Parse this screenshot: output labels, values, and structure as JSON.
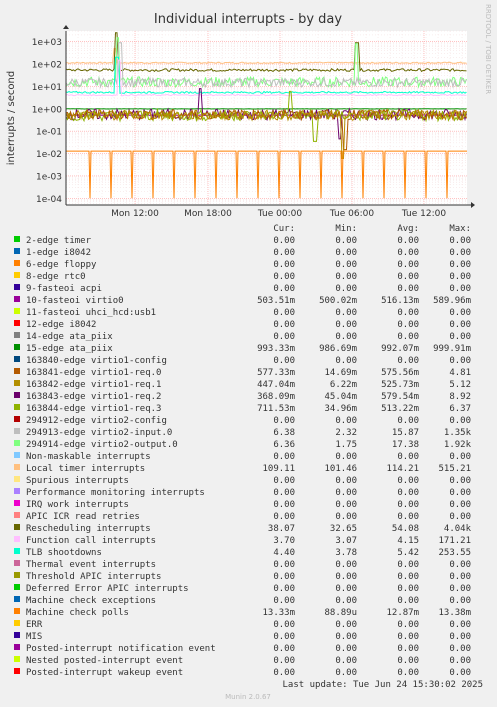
{
  "chart_data": {
    "type": "line",
    "title": "Individual interrupts - by day",
    "ylabel": "interrupts / second",
    "side_label": "RRDTOOL / TOBI OETIKER",
    "y_scale": "log",
    "ylim": [
      5e-05,
      3000
    ],
    "y_ticks": [
      "1e+03",
      "1e+02",
      "1e+01",
      "1e+00",
      "1e-01",
      "1e-02",
      "1e-03",
      "1e-04"
    ],
    "x_ticks": [
      "Mon 12:00",
      "Mon 18:00",
      "Tue 00:00",
      "Tue 06:00",
      "Tue 12:00"
    ],
    "grid": true,
    "background": "#ffffff",
    "grid_color": "#ff9f9f",
    "columns": [
      "Cur:",
      "Min:",
      "Avg:",
      "Max:"
    ],
    "series": [
      {
        "name": "2-edge      timer",
        "color": "#00cc00",
        "cur": "0.00",
        "min": "0.00",
        "avg": "0.00",
        "max": "0.00"
      },
      {
        "name": "1-edge      i8042",
        "color": "#0066b3",
        "cur": "0.00",
        "min": "0.00",
        "avg": "0.00",
        "max": "0.00"
      },
      {
        "name": "6-edge      floppy",
        "color": "#ff8000",
        "cur": "0.00",
        "min": "0.00",
        "avg": "0.00",
        "max": "0.00"
      },
      {
        "name": "8-edge      rtc0",
        "color": "#ffcc00",
        "cur": "0.00",
        "min": "0.00",
        "avg": "0.00",
        "max": "0.00"
      },
      {
        "name": "9-fasteoi   acpi",
        "color": "#330099",
        "cur": "0.00",
        "min": "0.00",
        "avg": "0.00",
        "max": "0.00"
      },
      {
        "name": "10-fasteoi   virtio0",
        "color": "#990099",
        "cur": "503.51m",
        "min": "500.02m",
        "avg": "516.13m",
        "max": "589.96m"
      },
      {
        "name": "11-fasteoi   uhci_hcd:usb1",
        "color": "#ccff00",
        "cur": "0.00",
        "min": "0.00",
        "avg": "0.00",
        "max": "0.00"
      },
      {
        "name": "12-edge      i8042",
        "color": "#ff0000",
        "cur": "0.00",
        "min": "0.00",
        "avg": "0.00",
        "max": "0.00"
      },
      {
        "name": "14-edge      ata_piix",
        "color": "#808080",
        "cur": "0.00",
        "min": "0.00",
        "avg": "0.00",
        "max": "0.00"
      },
      {
        "name": "15-edge      ata_piix",
        "color": "#008f00",
        "cur": "993.33m",
        "min": "986.69m",
        "avg": "992.07m",
        "max": "999.91m"
      },
      {
        "name": "163840-edge      virtio1-config",
        "color": "#00487d",
        "cur": "0.00",
        "min": "0.00",
        "avg": "0.00",
        "max": "0.00"
      },
      {
        "name": "163841-edge      virtio1-req.0",
        "color": "#b35a00",
        "cur": "577.33m",
        "min": "14.69m",
        "avg": "575.56m",
        "max": "4.81"
      },
      {
        "name": "163842-edge      virtio1-req.1",
        "color": "#b38f00",
        "cur": "447.04m",
        "min": "6.22m",
        "avg": "525.73m",
        "max": "5.12"
      },
      {
        "name": "163843-edge      virtio1-req.2",
        "color": "#6b006b",
        "cur": "368.09m",
        "min": "45.04m",
        "avg": "579.54m",
        "max": "8.92"
      },
      {
        "name": "163844-edge      virtio1-req.3",
        "color": "#8fb300",
        "cur": "711.53m",
        "min": "34.96m",
        "avg": "513.22m",
        "max": "6.37"
      },
      {
        "name": "294912-edge      virtio2-config",
        "color": "#b30000",
        "cur": "0.00",
        "min": "0.00",
        "avg": "0.00",
        "max": "0.00"
      },
      {
        "name": "294913-edge      virtio2-input.0",
        "color": "#bebebe",
        "cur": "6.38",
        "min": "2.32",
        "avg": "15.87",
        "max": "1.35k"
      },
      {
        "name": "294914-edge      virtio2-output.0",
        "color": "#80ff80",
        "cur": "6.36",
        "min": "1.75",
        "avg": "17.38",
        "max": "1.92k"
      },
      {
        "name": "Non-maskable interrupts",
        "color": "#80c9ff",
        "cur": "0.00",
        "min": "0.00",
        "avg": "0.00",
        "max": "0.00"
      },
      {
        "name": "Local timer interrupts",
        "color": "#ffc080",
        "cur": "109.11",
        "min": "101.46",
        "avg": "114.21",
        "max": "515.21"
      },
      {
        "name": "Spurious interrupts",
        "color": "#ffe680",
        "cur": "0.00",
        "min": "0.00",
        "avg": "0.00",
        "max": "0.00"
      },
      {
        "name": "Performance monitoring interrupts",
        "color": "#aa80ff",
        "cur": "0.00",
        "min": "0.00",
        "avg": "0.00",
        "max": "0.00"
      },
      {
        "name": "IRQ work interrupts",
        "color": "#ee00cc",
        "cur": "0.00",
        "min": "0.00",
        "avg": "0.00",
        "max": "0.00"
      },
      {
        "name": "APIC ICR read retries",
        "color": "#ff8080",
        "cur": "0.00",
        "min": "0.00",
        "avg": "0.00",
        "max": "0.00"
      },
      {
        "name": "Rescheduling interrupts",
        "color": "#666600",
        "cur": "38.07",
        "min": "32.65",
        "avg": "54.08",
        "max": "4.04k"
      },
      {
        "name": "Function call interrupts",
        "color": "#ffbfff",
        "cur": "3.70",
        "min": "3.07",
        "avg": "4.15",
        "max": "171.21"
      },
      {
        "name": "TLB shootdowns",
        "color": "#00ffcc",
        "cur": "4.40",
        "min": "3.78",
        "avg": "5.42",
        "max": "253.55"
      },
      {
        "name": "Thermal event interrupts",
        "color": "#cc6699",
        "cur": "0.00",
        "min": "0.00",
        "avg": "0.00",
        "max": "0.00"
      },
      {
        "name": "Threshold APIC interrupts",
        "color": "#999900",
        "cur": "0.00",
        "min": "0.00",
        "avg": "0.00",
        "max": "0.00"
      },
      {
        "name": "Deferred Error APIC interrupts",
        "color": "#00cc00",
        "cur": "0.00",
        "min": "0.00",
        "avg": "0.00",
        "max": "0.00"
      },
      {
        "name": "Machine check exceptions",
        "color": "#0066b3",
        "cur": "0.00",
        "min": "0.00",
        "avg": "0.00",
        "max": "0.00"
      },
      {
        "name": "Machine check polls",
        "color": "#ff8000",
        "cur": "13.33m",
        "min": "88.89u",
        "avg": "12.87m",
        "max": "13.38m"
      },
      {
        "name": "ERR",
        "color": "#ffcc00",
        "cur": "0.00",
        "min": "0.00",
        "avg": "0.00",
        "max": "0.00"
      },
      {
        "name": "MIS",
        "color": "#330099",
        "cur": "0.00",
        "min": "0.00",
        "avg": "0.00",
        "max": "0.00"
      },
      {
        "name": "Posted-interrupt notification event",
        "color": "#990099",
        "cur": "0.00",
        "min": "0.00",
        "avg": "0.00",
        "max": "0.00"
      },
      {
        "name": "Nested posted-interrupt event",
        "color": "#ccff00",
        "cur": "0.00",
        "min": "0.00",
        "avg": "0.00",
        "max": "0.00"
      },
      {
        "name": "Posted-interrupt wakeup event",
        "color": "#ff0000",
        "cur": "0.00",
        "min": "0.00",
        "avg": "0.00",
        "max": "0.00"
      }
    ],
    "last_update": "Last update: Tue Jun 24 15:30:02 2025",
    "footer": "Munin 2.0.67"
  }
}
